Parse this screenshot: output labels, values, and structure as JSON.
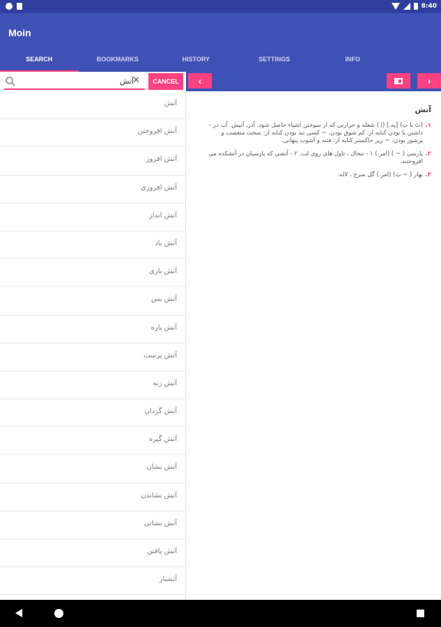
{
  "status_bar": {
    "time": "8:40"
  },
  "app": {
    "title": "Moin"
  },
  "tabs": [
    {
      "label": "SEARCH"
    },
    {
      "label": "BOOKMARKS"
    },
    {
      "label": "HISTORY"
    },
    {
      "label": "SETTINGS"
    },
    {
      "label": "INFO"
    }
  ],
  "search": {
    "value": "آتش",
    "cancel_label": "CANCEL"
  },
  "words": [
    "آتش",
    "آتش افروختن",
    "آتش افروز",
    "آتش افروزی",
    "آتش انداز",
    "آتش باد",
    "آتش بازی",
    "آتش بس",
    "آتش پاره",
    "آتش پرست",
    "آتش زنه",
    "آتش گردان",
    "آتش گیره",
    "آتش نشان",
    "آتش نشاندن",
    "آتش نشانی",
    "آتش یافتن",
    "آتشبار"
  ],
  "toolbar": {
    "prev_label": "‹",
    "next_label": "›"
  },
  "definition": {
    "title": "آتش",
    "items": [
      {
        "num": "۱.",
        "text": "(تَ یا تِ) [په.] (اِ.) شعله و حرارتی که از سوختن اشیاء حاصل شود. آذر، آتیش. آب در - داشتن یا بودن کنایه از: کم شوق بودن. ~ کسی تند بودن کنایه از: سخت متعصب و پرشور بودن. ~ زیر خاکستر کنایه از: فتنه و آشوب پنهانی."
      },
      {
        "num": "۲.",
        "text": "پارسی ( ~ ) (امر.) ۱ - تبخال ، تاول های روی لب. ۲ - آتشی که پارسیان در آتشکده می افروختند."
      },
      {
        "num": "۳.",
        "text": "بهار ( ~ بَ) (امر.) گل سرخ ، لاله."
      }
    ]
  },
  "colors": {
    "primary": "#3f51b5",
    "primary_dark": "#303f9f",
    "accent": "#ff4081"
  }
}
